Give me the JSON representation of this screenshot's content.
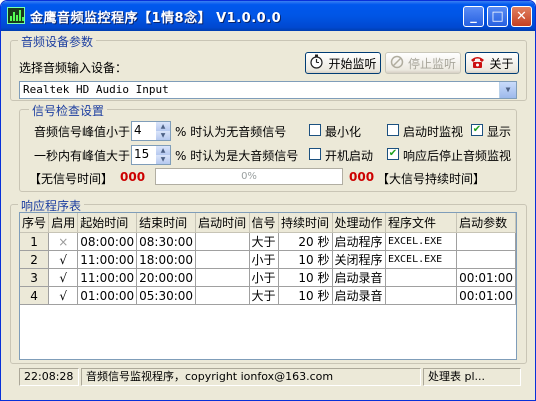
{
  "window": {
    "title": "金鹰音频监控程序【1情8念】 V1.0.0.0",
    "controls": {
      "minimize": "_",
      "maximize": "□",
      "close": "✕"
    }
  },
  "device_group": {
    "title": "音频设备参数",
    "select_label": "选择音频输入设备：",
    "selected_device": "Realtek HD Audio Input",
    "start_button": "开始监听",
    "stop_button": "停止监听",
    "about_button": "关于"
  },
  "signal_group": {
    "title": "信号检查设置",
    "row1_prefix": "音频信号峰值小于",
    "row1_value": "4",
    "row1_suffix": "% 时认为无音频信号",
    "row2_prefix": "一秒内有峰值大于",
    "row2_value": "15",
    "row2_suffix": "% 时认为是大音频信号",
    "checkboxes": {
      "minimize": {
        "label": "最小化",
        "checked": false
      },
      "autostart_listen": {
        "label": "启动时监视",
        "checked": false
      },
      "show": {
        "label": "显示",
        "checked": true
      },
      "boot_start": {
        "label": "开机启动",
        "checked": false
      },
      "stop_after_response": {
        "label": "响应后停止音频监视",
        "checked": true
      }
    },
    "no_signal_label": "【无信号时间】",
    "no_signal_value": "000",
    "progress_text": "0%",
    "progress_value": 0,
    "big_signal_value": "000",
    "big_signal_label": "【大信号持续时间】"
  },
  "response_group": {
    "title": "响应程序表",
    "columns": [
      "序号",
      "启用",
      "起始时间",
      "结束时间",
      "启动时间",
      "信号",
      "持续时间",
      "处理动作",
      "程序文件",
      "启动参数"
    ],
    "rows": [
      {
        "no": "1",
        "enabled": "×",
        "start": "08:00:00",
        "end": "08:30:00",
        "launch": "",
        "signal": "大于",
        "duration": "20 秒",
        "action": "启动程序",
        "file": "EXCEL.EXE",
        "param": ""
      },
      {
        "no": "2",
        "enabled": "√",
        "start": "11:00:00",
        "end": "18:00:00",
        "launch": "",
        "signal": "小于",
        "duration": "10 秒",
        "action": "关闭程序",
        "file": "EXCEL.EXE",
        "param": ""
      },
      {
        "no": "3",
        "enabled": "√",
        "start": "11:00:00",
        "end": "20:00:00",
        "launch": "",
        "signal": "小于",
        "duration": "10 秒",
        "action": "启动录音",
        "file": "",
        "param": "00:01:00"
      },
      {
        "no": "4",
        "enabled": "√",
        "start": "01:00:00",
        "end": "05:30:00",
        "launch": "",
        "signal": "大于",
        "duration": "10 秒",
        "action": "启动录音",
        "file": "",
        "param": "00:01:00"
      }
    ]
  },
  "statusbar": {
    "time": "22:08:28",
    "message": "音频信号监视程序，copyright ionfox@163.com",
    "right": "处理表 pl..."
  }
}
